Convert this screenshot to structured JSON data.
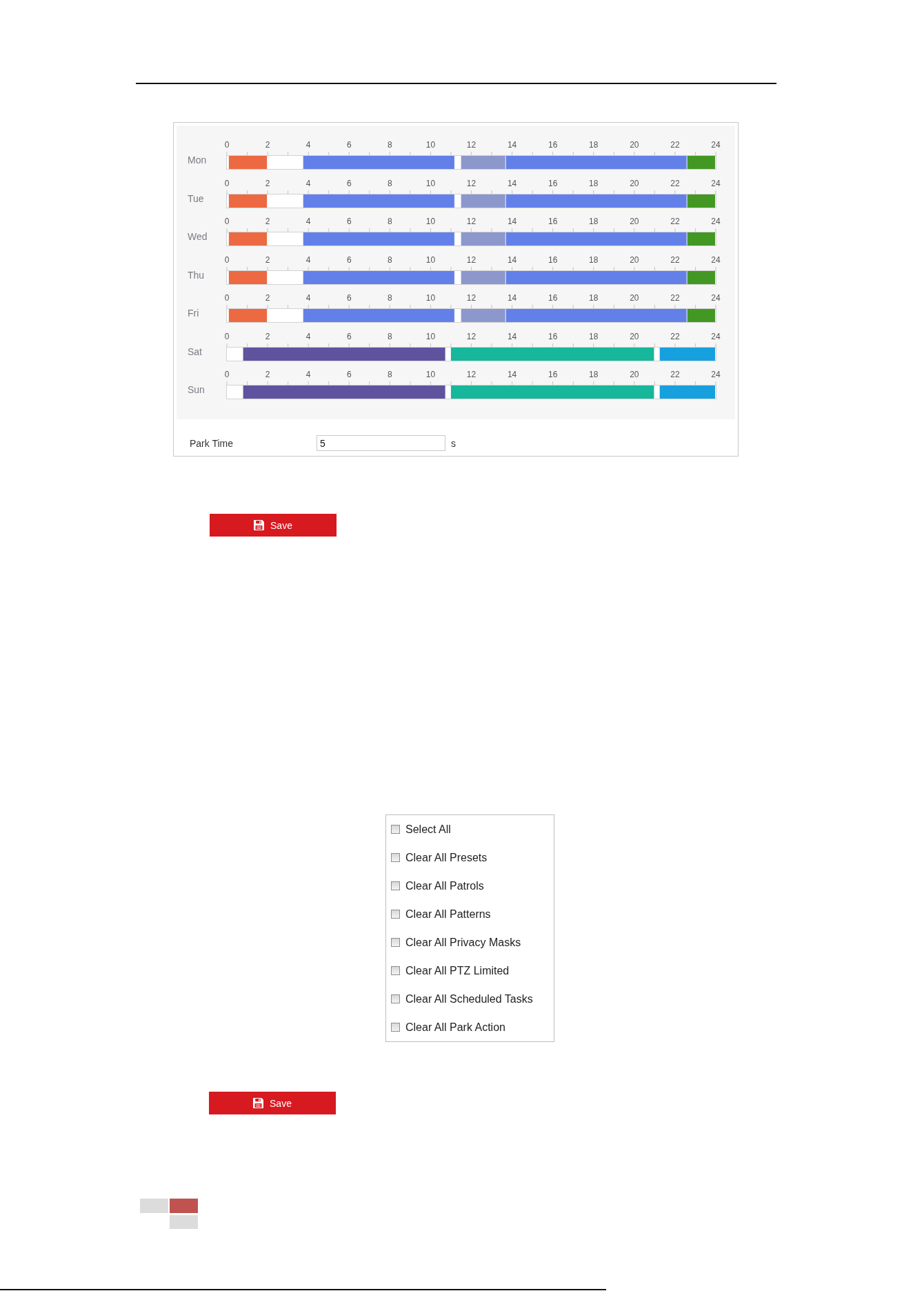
{
  "schedule": {
    "days": [
      {
        "chart_data": {
          "type": "bar",
          "orientation": "horizontal",
          "stacked": true,
          "categories": [
            "Mon"
          ],
          "xlim": [
            0,
            24
          ],
          "xticks": [
            0,
            2,
            4,
            6,
            8,
            10,
            12,
            14,
            16,
            18,
            20,
            22,
            24
          ],
          "series": [
            {
              "color": "#ffffff",
              "values": [
                0.1
              ]
            },
            {
              "color": "#ec6941",
              "values": [
                1.9
              ]
            },
            {
              "color": "#ffffff",
              "values": [
                1.75
              ]
            },
            {
              "color": "#6380e9",
              "values": [
                7.45
              ]
            },
            {
              "color": "#ffffff",
              "values": [
                0.3
              ]
            },
            {
              "color": "#8c98cc",
              "values": [
                2.2
              ]
            },
            {
              "color": "#6380e9",
              "values": [
                8.9
              ]
            },
            {
              "color": "#439823",
              "values": [
                1.4
              ]
            }
          ]
        }
      },
      {
        "chart_data": {
          "type": "bar",
          "orientation": "horizontal",
          "stacked": true,
          "categories": [
            "Tue"
          ],
          "xlim": [
            0,
            24
          ],
          "xticks": [
            0,
            2,
            4,
            6,
            8,
            10,
            12,
            14,
            16,
            18,
            20,
            22,
            24
          ],
          "series": [
            {
              "color": "#ffffff",
              "values": [
                0.1
              ]
            },
            {
              "color": "#ec6941",
              "values": [
                1.9
              ]
            },
            {
              "color": "#ffffff",
              "values": [
                1.75
              ]
            },
            {
              "color": "#6380e9",
              "values": [
                7.45
              ]
            },
            {
              "color": "#ffffff",
              "values": [
                0.3
              ]
            },
            {
              "color": "#8c98cc",
              "values": [
                2.2
              ]
            },
            {
              "color": "#6380e9",
              "values": [
                8.9
              ]
            },
            {
              "color": "#439823",
              "values": [
                1.4
              ]
            }
          ]
        }
      },
      {
        "chart_data": {
          "type": "bar",
          "orientation": "horizontal",
          "stacked": true,
          "categories": [
            "Wed"
          ],
          "xlim": [
            0,
            24
          ],
          "xticks": [
            0,
            2,
            4,
            6,
            8,
            10,
            12,
            14,
            16,
            18,
            20,
            22,
            24
          ],
          "series": [
            {
              "color": "#ffffff",
              "values": [
                0.1
              ]
            },
            {
              "color": "#ec6941",
              "values": [
                1.9
              ]
            },
            {
              "color": "#ffffff",
              "values": [
                1.75
              ]
            },
            {
              "color": "#6380e9",
              "values": [
                7.45
              ]
            },
            {
              "color": "#ffffff",
              "values": [
                0.3
              ]
            },
            {
              "color": "#8c98cc",
              "values": [
                2.2
              ]
            },
            {
              "color": "#6380e9",
              "values": [
                8.9
              ]
            },
            {
              "color": "#439823",
              "values": [
                1.4
              ]
            }
          ]
        }
      },
      {
        "chart_data": {
          "type": "bar",
          "orientation": "horizontal",
          "stacked": true,
          "categories": [
            "Thu"
          ],
          "xlim": [
            0,
            24
          ],
          "xticks": [
            0,
            2,
            4,
            6,
            8,
            10,
            12,
            14,
            16,
            18,
            20,
            22,
            24
          ],
          "series": [
            {
              "color": "#ffffff",
              "values": [
                0.1
              ]
            },
            {
              "color": "#ec6941",
              "values": [
                1.9
              ]
            },
            {
              "color": "#ffffff",
              "values": [
                1.75
              ]
            },
            {
              "color": "#6380e9",
              "values": [
                7.45
              ]
            },
            {
              "color": "#ffffff",
              "values": [
                0.3
              ]
            },
            {
              "color": "#8c98cc",
              "values": [
                2.2
              ]
            },
            {
              "color": "#6380e9",
              "values": [
                8.9
              ]
            },
            {
              "color": "#439823",
              "values": [
                1.4
              ]
            }
          ]
        }
      },
      {
        "chart_data": {
          "type": "bar",
          "orientation": "horizontal",
          "stacked": true,
          "categories": [
            "Fri"
          ],
          "xlim": [
            0,
            24
          ],
          "xticks": [
            0,
            2,
            4,
            6,
            8,
            10,
            12,
            14,
            16,
            18,
            20,
            22,
            24
          ],
          "series": [
            {
              "color": "#ffffff",
              "values": [
                0.1
              ]
            },
            {
              "color": "#ec6941",
              "values": [
                1.9
              ]
            },
            {
              "color": "#ffffff",
              "values": [
                1.75
              ]
            },
            {
              "color": "#6380e9",
              "values": [
                7.45
              ]
            },
            {
              "color": "#ffffff",
              "values": [
                0.3
              ]
            },
            {
              "color": "#8c98cc",
              "values": [
                2.2
              ]
            },
            {
              "color": "#6380e9",
              "values": [
                8.9
              ]
            },
            {
              "color": "#439823",
              "values": [
                1.4
              ]
            }
          ]
        }
      },
      {
        "chart_data": {
          "type": "bar",
          "orientation": "horizontal",
          "stacked": true,
          "categories": [
            "Sat"
          ],
          "xlim": [
            0,
            24
          ],
          "xticks": [
            0,
            2,
            4,
            6,
            8,
            10,
            12,
            14,
            16,
            18,
            20,
            22,
            24
          ],
          "series": [
            {
              "color": "#ffffff",
              "values": [
                0.8
              ]
            },
            {
              "color": "#5f53a0",
              "values": [
                9.95
              ]
            },
            {
              "color": "#ffffff",
              "values": [
                0.25
              ]
            },
            {
              "color": "#16b79b",
              "values": [
                10
              ]
            },
            {
              "color": "#ffffff",
              "values": [
                0.25
              ]
            },
            {
              "color": "#17a0de",
              "values": [
                2.75
              ]
            }
          ]
        }
      },
      {
        "chart_data": {
          "type": "bar",
          "orientation": "horizontal",
          "stacked": true,
          "categories": [
            "Sun"
          ],
          "xlim": [
            0,
            24
          ],
          "xticks": [
            0,
            2,
            4,
            6,
            8,
            10,
            12,
            14,
            16,
            18,
            20,
            22,
            24
          ],
          "series": [
            {
              "color": "#ffffff",
              "values": [
                0.8
              ]
            },
            {
              "color": "#5f53a0",
              "values": [
                9.95
              ]
            },
            {
              "color": "#ffffff",
              "values": [
                0.25
              ]
            },
            {
              "color": "#16b79b",
              "values": [
                10
              ]
            },
            {
              "color": "#ffffff",
              "values": [
                0.25
              ]
            },
            {
              "color": "#17a0de",
              "values": [
                2.75
              ]
            }
          ]
        }
      }
    ]
  },
  "park_time": {
    "label": "Park Time",
    "value": "5",
    "unit": "s"
  },
  "schedule_save": {
    "label": "Save"
  },
  "clear_options": {
    "items": [
      {
        "label": "Select All",
        "checked": false
      },
      {
        "label": "Clear All Presets",
        "checked": false
      },
      {
        "label": "Clear All Patrols",
        "checked": false
      },
      {
        "label": "Clear All Patterns",
        "checked": false
      },
      {
        "label": "Clear All Privacy Masks",
        "checked": false
      },
      {
        "label": "Clear All PTZ Limited",
        "checked": false
      },
      {
        "label": "Clear All Scheduled Tasks",
        "checked": false
      },
      {
        "label": "Clear All Park Action",
        "checked": false
      }
    ]
  },
  "clear_save": {
    "label": "Save"
  }
}
